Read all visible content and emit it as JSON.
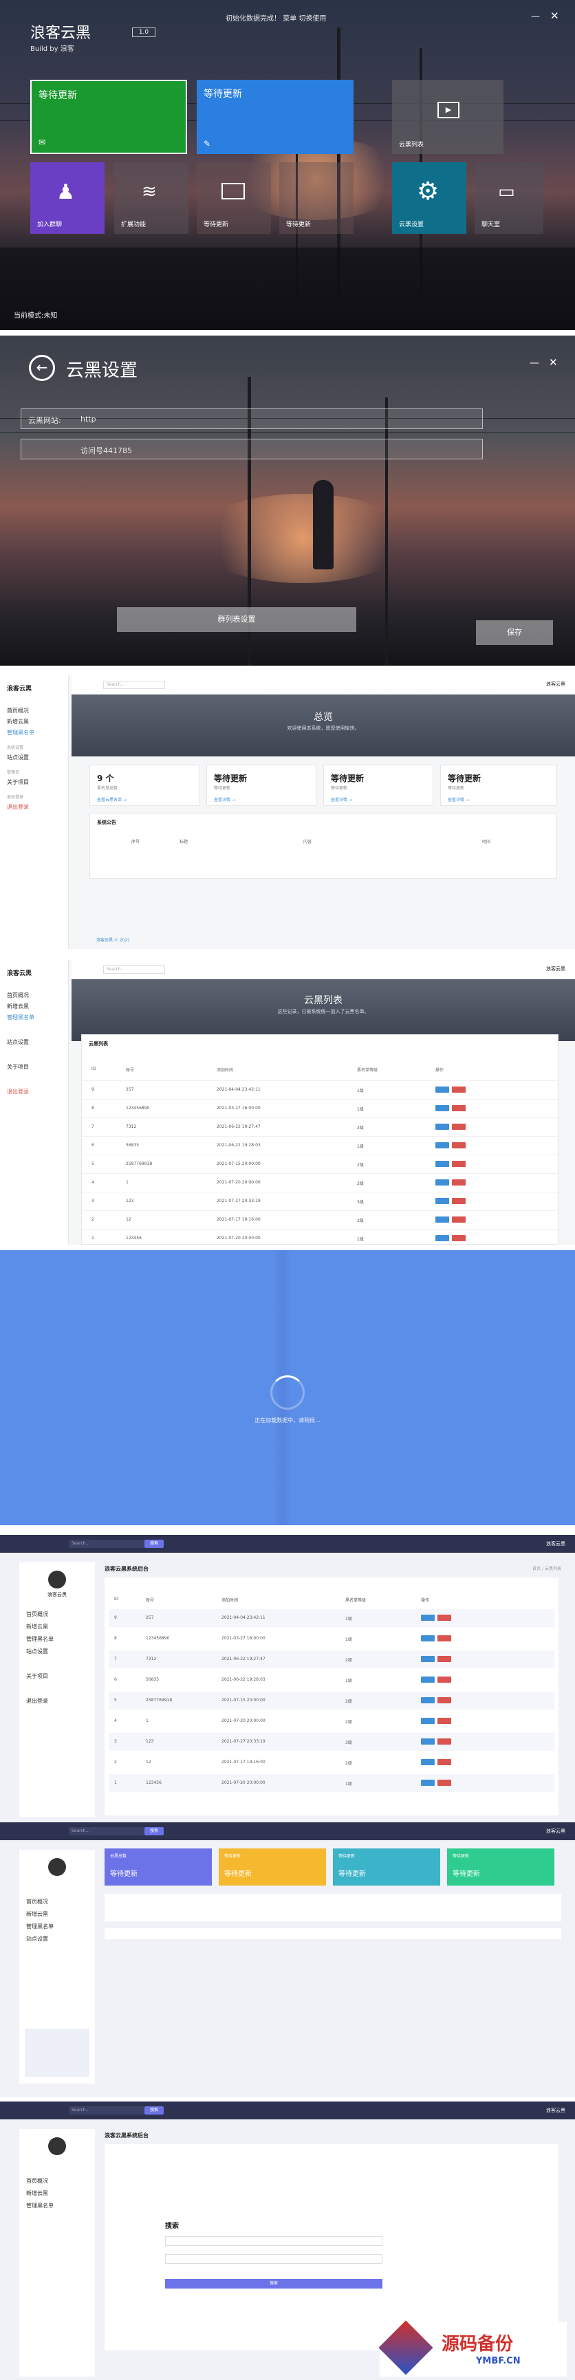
{
  "window1": {
    "app_title": "浪客云黑",
    "subtitle": "Build by 浪客",
    "version_badge": "1.0",
    "notice": "初始化数据完成！ 菜单  切换使用",
    "status_bar": "当前模式:未知",
    "tiles": [
      {
        "label": "等待更新",
        "color": "#1a9a2e"
      },
      {
        "label": "等待更新",
        "color": "#2b7fe0"
      },
      {
        "label": "云黑列表"
      },
      {
        "label": "加入群聊",
        "color": "#6a3fc4"
      },
      {
        "label": "扩展功能"
      },
      {
        "label": "等待更新"
      },
      {
        "label": "等待更新"
      },
      {
        "label": "云黑设置",
        "color": "#0f6f8a"
      },
      {
        "label": "聊天室"
      }
    ]
  },
  "window2": {
    "title": "云黑设置",
    "api_label": "云黑网站:",
    "api_value": "http",
    "qq_value": "访问号441785",
    "test_button": "群列表设置",
    "save_button": "保存"
  },
  "admin": {
    "brand": "浪客云黑",
    "search_placeholder": "Search...",
    "user": "浪客云黑",
    "sidebar_sections": [
      "仪表盘",
      "系统设置",
      "管理员",
      "退出登录"
    ],
    "sidebar_items": [
      "首页概况",
      "新增云黑",
      "管理黑名单",
      "站点设置",
      "关于项目",
      "退出登录"
    ],
    "dashboard": {
      "hero_title": "总览",
      "hero_sub": "欢迎使用本系统，愿您使用愉快。",
      "stats": [
        {
          "value": "9 个",
          "label": "黑名单总数",
          "link": "查看云黑名单 →"
        },
        {
          "value": "等待更新",
          "label": "等待更新",
          "link": "查看详情 →"
        },
        {
          "value": "等待更新",
          "label": "等待更新",
          "link": "查看详情 →"
        },
        {
          "value": "等待更新",
          "label": "等待更新",
          "link": "查看详情 →"
        }
      ],
      "panel_title": "系统公告",
      "panel_cols": [
        "序号",
        "标题",
        "内容",
        "时间"
      ],
      "footer": "浪客云黑 © 2021"
    },
    "list": {
      "hero_title": "云黑列表",
      "hero_sub": "这些记录，已被系统统一加入了云黑名单。",
      "panel_title": "云黑列表",
      "columns": [
        "ID",
        "账号",
        "添加时间",
        "黑名单等级",
        "操作"
      ],
      "rows": [
        {
          "id": "9",
          "account": "257",
          "time": "2021-04-04 23:42:11",
          "level": "1级"
        },
        {
          "id": "8",
          "account": "123456890",
          "time": "2021-03-27 16:00:00",
          "level": "1级"
        },
        {
          "id": "7",
          "account": "7312",
          "time": "2021-06-22 19:27:47",
          "level": "2级"
        },
        {
          "id": "6",
          "account": "56835",
          "time": "2021-06-22 19:28:03",
          "level": "1级"
        },
        {
          "id": "5",
          "account": "2587769918",
          "time": "2021-07-15 20:00:00",
          "level": "2级"
        },
        {
          "id": "4",
          "account": "1",
          "time": "2021-07-20 20:00:00",
          "level": "2级"
        },
        {
          "id": "3",
          "account": "123",
          "time": "2021-07-27 20:33:19",
          "level": "3级"
        },
        {
          "id": "2",
          "account": "12",
          "time": "2021-07-17 19:16:00",
          "level": "2级"
        },
        {
          "id": "1",
          "account": "123456",
          "time": "2021-07-20 20:00:00",
          "level": "1级"
        }
      ],
      "edit_label": "编辑",
      "delete_label": "删除"
    },
    "loading_text": "正在加载数据中，请稍候...",
    "theme2": {
      "page_title": "浪客云黑系统后台",
      "breadcrumb": "首页 / 云黑列表",
      "search_title": "搜索",
      "search_button": "搜索",
      "cards": [
        {
          "title": "云黑总数",
          "value": "等待更新",
          "color": "#6c72e8"
        },
        {
          "title": "等待更新",
          "value": "等待更新",
          "color": "#f5b82e"
        },
        {
          "title": "等待更新",
          "value": "等待更新",
          "color": "#3bb3c9"
        },
        {
          "title": "等待更新",
          "value": "等待更新",
          "color": "#2ecc8f"
        }
      ]
    }
  },
  "watermark": {
    "text": "源码备份",
    "domain": "YMBF.CN"
  }
}
